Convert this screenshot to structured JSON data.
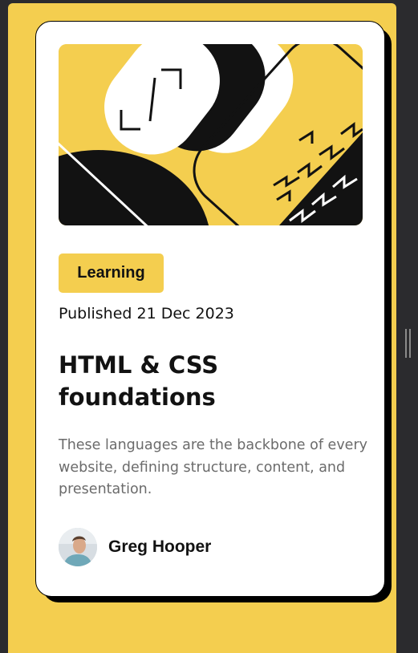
{
  "card": {
    "category": "Learning",
    "published": "Published 21 Dec 2023",
    "title": "HTML & CSS foundations",
    "description": "These languages are the backbone of every website, defining structure, content, and presentation.",
    "author": "Greg Hooper"
  },
  "colors": {
    "accent": "#f4ce4f",
    "text": "#121212",
    "muted": "#6b6b6b",
    "page_background": "#2b2b2e"
  },
  "icons": {
    "hero": "illustration-article",
    "avatar": "avatar-photo",
    "scrollbar": "scrollbar-grip"
  }
}
